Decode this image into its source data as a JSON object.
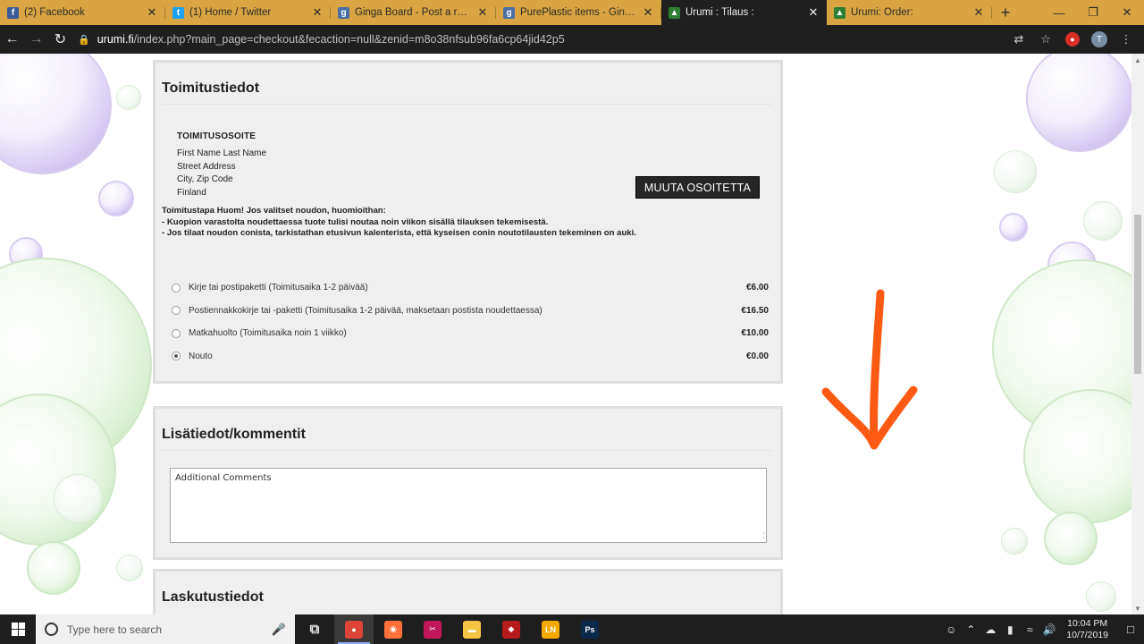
{
  "browser": {
    "tabs": [
      {
        "title": "(2) Facebook",
        "icon": "facebook-icon",
        "color": "#3b5998",
        "glyph": "f",
        "active": false
      },
      {
        "title": "(1) Home / Twitter",
        "icon": "twitter-icon",
        "color": "#1da1f2",
        "glyph": "t",
        "active": false
      },
      {
        "title": "Ginga Board - Post a reply",
        "icon": "ginga-board-icon",
        "color": "#4a6fa5",
        "glyph": "g",
        "active": false
      },
      {
        "title": "PurePlastic items - Ginga Bo",
        "icon": "ginga-board-icon",
        "color": "#4a6fa5",
        "glyph": "g",
        "active": false
      },
      {
        "title": "Urumi : Tilaus :",
        "icon": "urumi-icon",
        "color": "#2e7d32",
        "glyph": "▲",
        "active": true
      },
      {
        "title": "Urumi: Order:",
        "icon": "urumi-icon",
        "color": "#2e7d32",
        "glyph": "▲",
        "active": false
      }
    ],
    "url_host": "urumi.fi",
    "url_rest": "/index.php?main_page=checkout&fecaction=null&zenid=m8o38nfsub96fa6cp64jid42p5",
    "profile_initial": "T"
  },
  "shipping": {
    "title": "Toimitustiedot",
    "address_heading": "TOIMITUSOSOITE",
    "address_lines": [
      "First Name Last Name",
      "Street Address",
      "City, Zip Code",
      "Finland"
    ],
    "change_button": "MUUTA OSOITETTA",
    "notice_lines": [
      "Toimitustapa Huom! Jos valitset noudon, huomioithan:",
      "- Kuopion varastolta noudettaessa tuote tulisi noutaa noin viikon sisällä tilauksen tekemisestä.",
      "- Jos tilaat noudon conista, tarkistathan etusivun kalenterista, että kyseisen conin noutotilausten tekeminen on auki."
    ],
    "options": [
      {
        "label": "Kirje tai postipaketti (Toimitusaika 1-2 päivää)",
        "price": "€6.00",
        "selected": false
      },
      {
        "label": "Postiennakkokirje tai -paketti (Toimitusaika 1-2 päivää, maksetaan postista noudettaessa)",
        "price": "€16.50",
        "selected": false
      },
      {
        "label": "Matkahuolto (Toimitusaika noin 1 viikko)",
        "price": "€10.00",
        "selected": false
      },
      {
        "label": "Nouto",
        "price": "€0.00",
        "selected": true
      }
    ]
  },
  "comments": {
    "title": "Lisätiedot/kommentit",
    "placeholder": "Additional Comments"
  },
  "billing": {
    "title": "Laskutustiedot"
  },
  "annotation": {
    "arrow_color": "#ff5a14"
  },
  "taskbar": {
    "search_placeholder": "Type here to search",
    "apps": [
      {
        "name": "task-view-icon",
        "glyph": "⧉",
        "color": "transparent",
        "active": false
      },
      {
        "name": "chrome-icon",
        "glyph": "●",
        "color": "#db4437",
        "active": true
      },
      {
        "name": "firefox-icon",
        "glyph": "◉",
        "color": "#ff7139",
        "active": false
      },
      {
        "name": "snipping-tool-icon",
        "glyph": "✂",
        "color": "#c2185b",
        "active": false
      },
      {
        "name": "file-explorer-icon",
        "glyph": "▬",
        "color": "#f4c542",
        "active": false
      },
      {
        "name": "red-app-icon",
        "glyph": "◆",
        "color": "#b71c1c",
        "active": false
      },
      {
        "name": "ln-app-icon",
        "glyph": "LN",
        "color": "#f2a900",
        "active": false
      },
      {
        "name": "photoshop-icon",
        "glyph": "Ps",
        "color": "#0b2a4a",
        "active": false
      }
    ],
    "time": "10:04 PM",
    "date": "10/7/2019"
  }
}
